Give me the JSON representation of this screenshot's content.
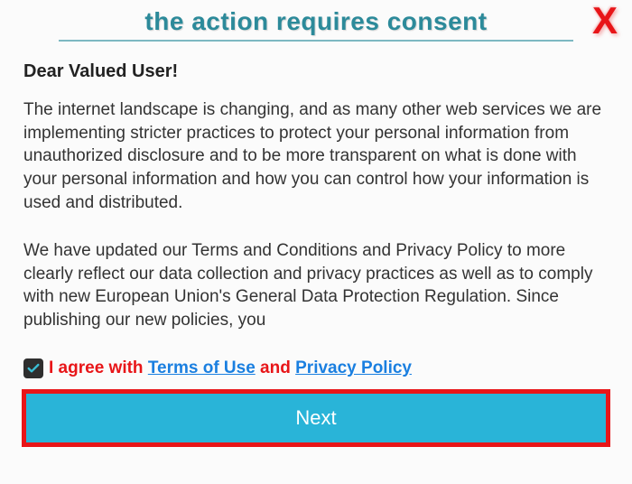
{
  "dialog": {
    "title": "the action requires consent",
    "close_label": "X",
    "greeting": "Dear Valued User!",
    "paragraph1": "The internet landscape is changing, and as many other web services we are implementing stricter practices to protect your personal information from unauthorized disclosure and to be more transparent on what is done with your personal information and how you can control how your information is used and distributed.",
    "paragraph2": "We have updated our Terms and Conditions and Privacy Policy to more clearly reflect our data collection and privacy practices as well as to comply with new European Union's General Data Protection Regulation. Since publishing our new policies, you",
    "consent": {
      "prefix": "I agree with ",
      "terms_link": "Terms of Use",
      "middle": " and ",
      "privacy_link": "Privacy Policy"
    },
    "next_button": "Next"
  }
}
